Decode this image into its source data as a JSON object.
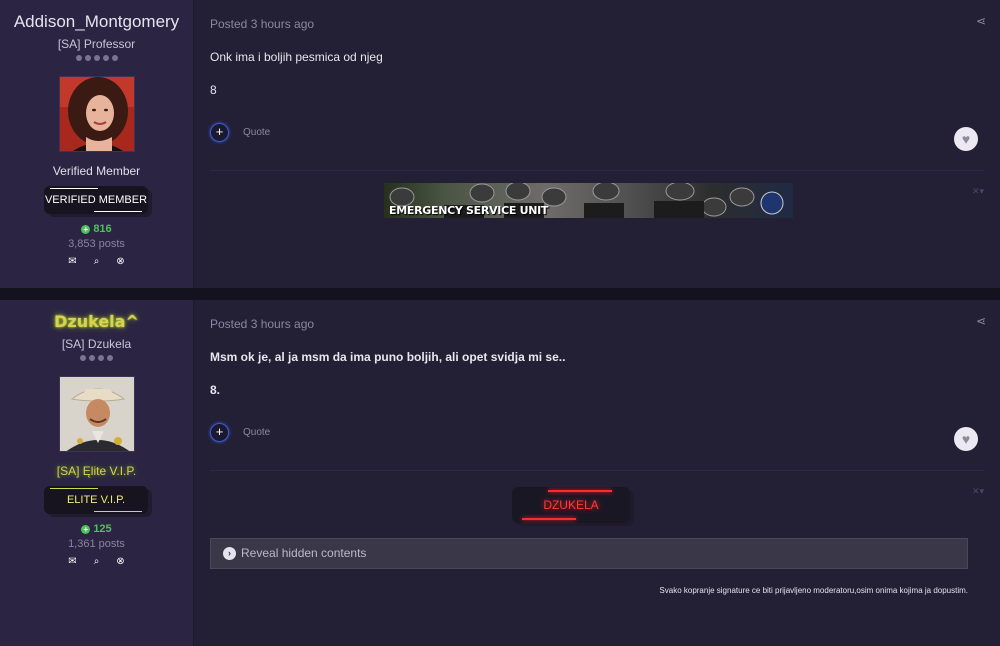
{
  "posts": [
    {
      "author": {
        "name": "Addison_Montgomery",
        "title": "[SA] Professor",
        "group": "Verified Member",
        "badge": "VERIFIED MEMBER",
        "reputation": "816",
        "posts": "3,853 posts"
      },
      "meta": "Posted 3 hours ago",
      "lines": [
        "Onk ima i boljih pesmica od njeg",
        "8"
      ],
      "quote_label": "Quote",
      "signature_banner_text": "EMERGENCY SERVICE UNIT",
      "close_glyph": "✕▾"
    },
    {
      "author": {
        "name": "Dzukela^",
        "title": "[SA] Dzukela",
        "group": "[SA] Ęlite V.I.P.",
        "badge": "ELITE V.I.P.",
        "reputation": "125",
        "posts": "1,361 posts"
      },
      "meta": "Posted 3 hours ago",
      "lines": [
        "Msm ok je, al ja msm da ima puno boljih, ali opet svidja mi se..",
        "8."
      ],
      "quote_label": "Quote",
      "signature_text": "DZUKELA",
      "reveal_label": "Reveal hidden contents",
      "signature_note": "Svako kopranje signature ce biti prijavljeno moderatoru,osim onima kojima ja dopustim.",
      "close_glyph": "✕▾"
    }
  ],
  "icons": {
    "mail": "✉",
    "search": "⌕",
    "ignore": "⊗",
    "plus": "+",
    "heart": "♥",
    "share": "⋖",
    "rep": "+",
    "reveal": "›"
  },
  "colors": {
    "author_bg": "#2b2543",
    "body_bg": "#231f35",
    "rep_green": "#4cc25a",
    "elite_gold": "#d9d24a",
    "sig_red": "#ff3a3a"
  }
}
